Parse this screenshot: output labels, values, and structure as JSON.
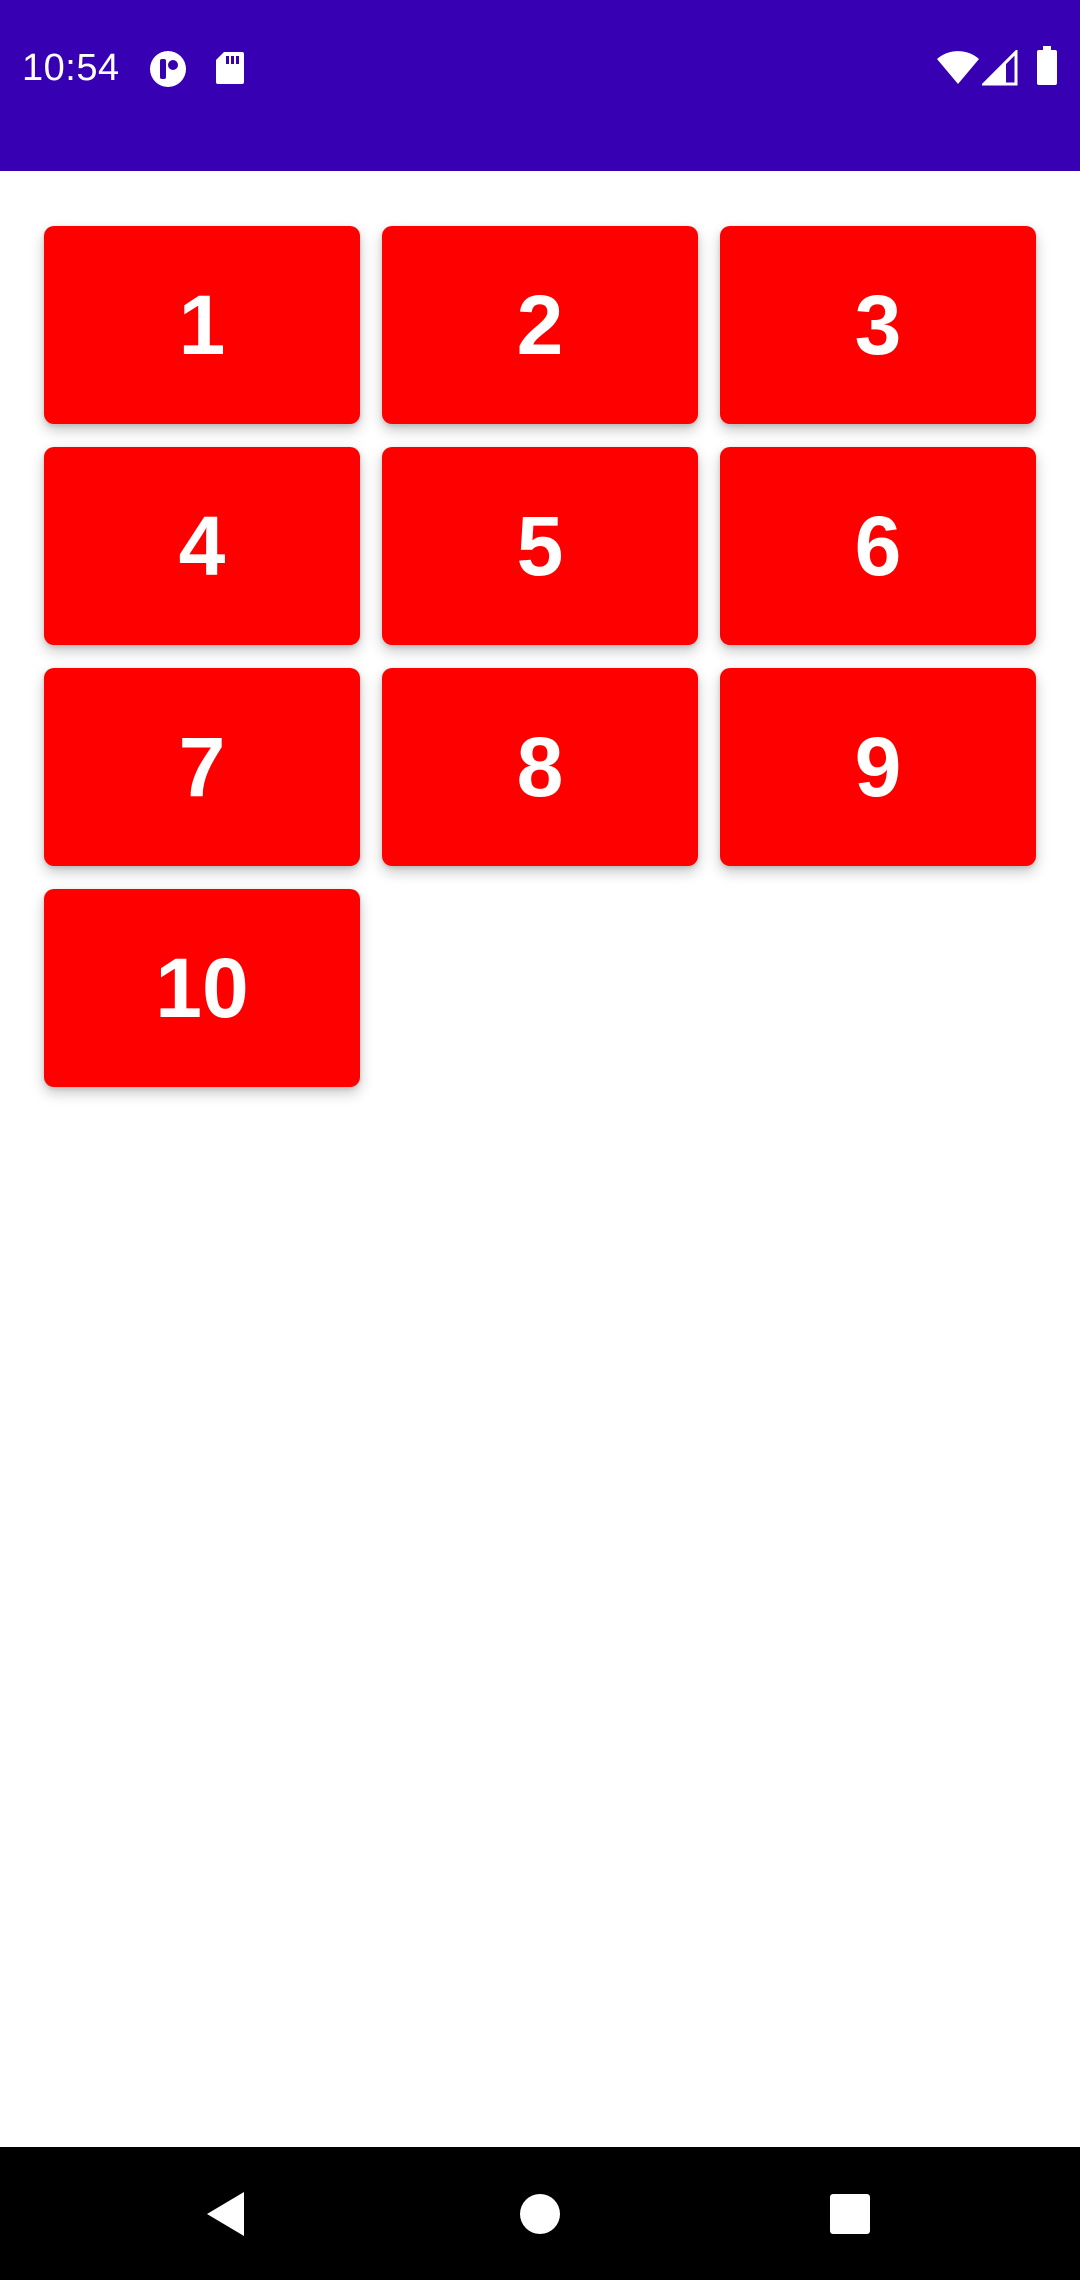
{
  "status_bar": {
    "time": "10:54",
    "background": "#3700b3",
    "left_icons": [
      "app-notification-icon",
      "sd-card-icon"
    ],
    "right_icons": [
      "wifi-icon",
      "cellular-signal-icon",
      "battery-icon"
    ]
  },
  "grid": {
    "tile_color": "#ff0000",
    "text_color": "#ffffff",
    "tiles": [
      {
        "label": "1"
      },
      {
        "label": "2"
      },
      {
        "label": "3"
      },
      {
        "label": "4"
      },
      {
        "label": "5"
      },
      {
        "label": "6"
      },
      {
        "label": "7"
      },
      {
        "label": "8"
      },
      {
        "label": "9"
      },
      {
        "label": "10"
      }
    ]
  },
  "nav_bar": {
    "background": "#000000",
    "buttons": [
      "back-icon",
      "home-icon",
      "recents-icon"
    ]
  }
}
